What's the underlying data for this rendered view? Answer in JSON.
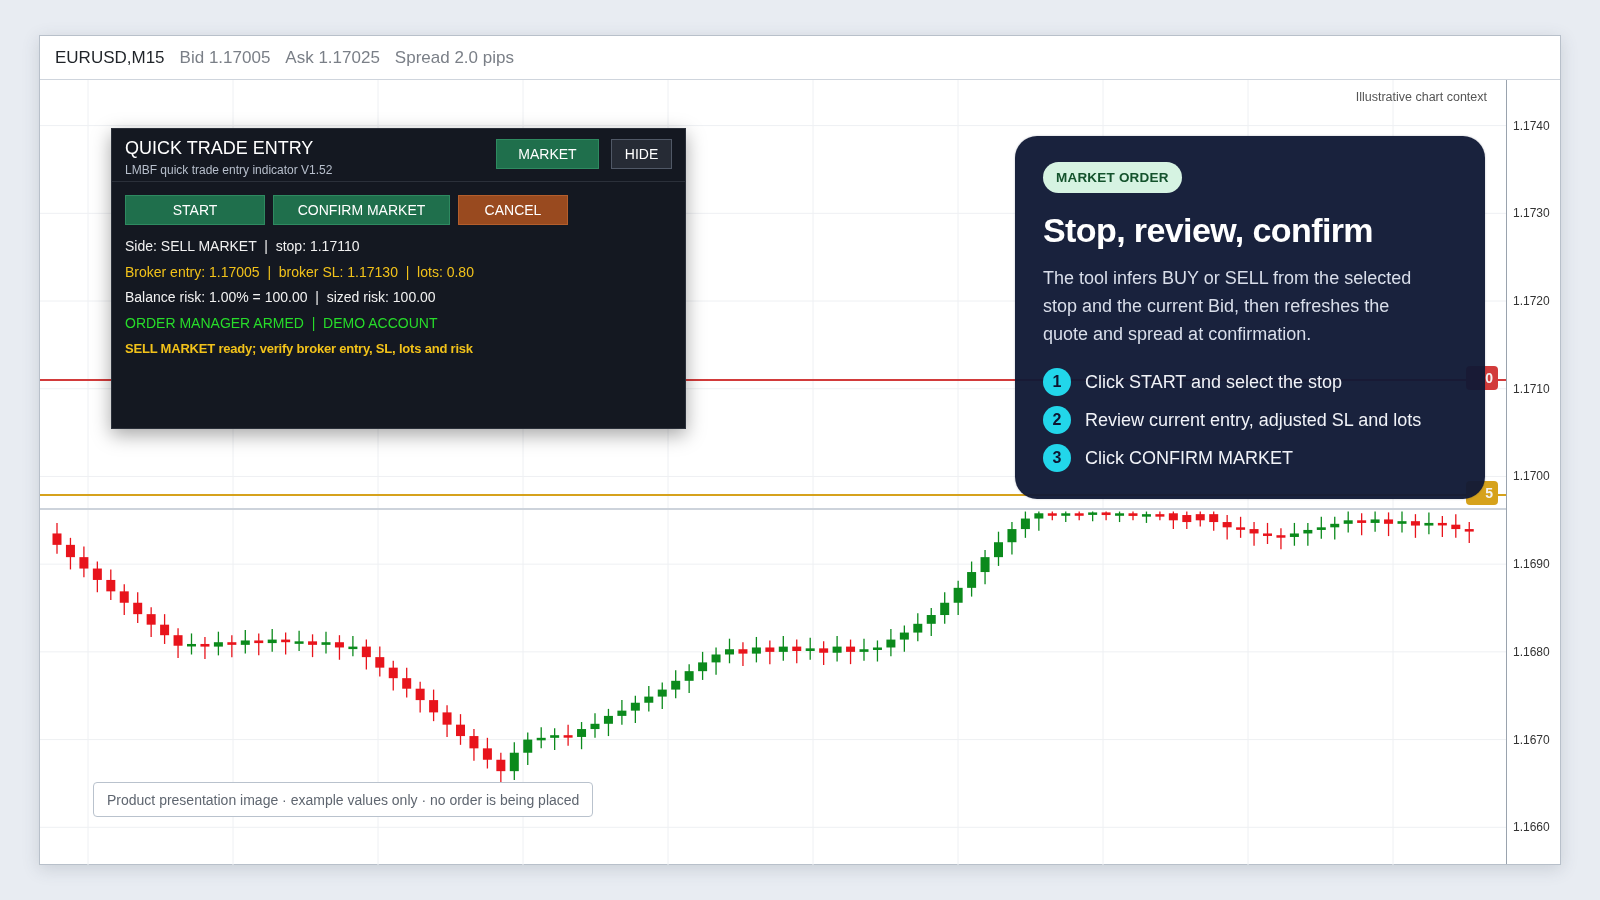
{
  "header": {
    "symbol": "EURUSD,M15",
    "bid": "Bid 1.17005",
    "ask": "Ask 1.17025",
    "spread": "Spread 2.0 pips"
  },
  "chart": {
    "note": "Illustrative chart context",
    "levels": [
      {
        "kind": "stop",
        "label": "0",
        "color": "#d23b3b"
      },
      {
        "kind": "entry",
        "label": "5",
        "color": "#d6a21c"
      },
      {
        "kind": "bid",
        "color": "#cdd3db"
      }
    ],
    "chart_data": {
      "type": "candlestick",
      "ylim": [
        1.16557,
        1.17452
      ],
      "grid": true,
      "yticks": [
        {
          "value": 1.174,
          "label": "1.1740"
        },
        {
          "value": 1.173,
          "label": "1.1730"
        },
        {
          "value": 1.172,
          "label": "1.1720"
        },
        {
          "value": 1.171,
          "label": "1.1710"
        },
        {
          "value": 1.17,
          "label": "1.1700"
        },
        {
          "value": 1.169,
          "label": "1.1690"
        },
        {
          "value": 1.168,
          "label": "1.1680"
        },
        {
          "value": 1.167,
          "label": "1.1670"
        },
        {
          "value": 1.166,
          "label": "1.1660"
        }
      ],
      "ohlc": [
        [
          1.16935,
          1.16947,
          1.16912,
          1.16922
        ],
        [
          1.16922,
          1.1693,
          1.16894,
          1.16908
        ],
        [
          1.16908,
          1.1692,
          1.16885,
          1.16895
        ],
        [
          1.16895,
          1.16903,
          1.16868,
          1.16882
        ],
        [
          1.16882,
          1.16894,
          1.16859,
          1.16869
        ],
        [
          1.16869,
          1.16877,
          1.16842,
          1.16856
        ],
        [
          1.16856,
          1.16868,
          1.16833,
          1.16843
        ],
        [
          1.16843,
          1.16851,
          1.16817,
          1.16831
        ],
        [
          1.16831,
          1.16843,
          1.16809,
          1.16819
        ],
        [
          1.16819,
          1.16827,
          1.16793,
          1.16807
        ],
        [
          1.16807,
          1.16821,
          1.16797,
          1.16809
        ],
        [
          1.16809,
          1.16817,
          1.16792,
          1.16806
        ],
        [
          1.16806,
          1.16823,
          1.16796,
          1.16811
        ],
        [
          1.16811,
          1.16819,
          1.16794,
          1.16808
        ],
        [
          1.16808,
          1.16825,
          1.16798,
          1.16813
        ],
        [
          1.16813,
          1.16821,
          1.16796,
          1.1681
        ],
        [
          1.1681,
          1.16826,
          1.168,
          1.16814
        ],
        [
          1.16814,
          1.16822,
          1.16797,
          1.16811
        ],
        [
          1.16811,
          1.16824,
          1.16801,
          1.16812
        ],
        [
          1.16812,
          1.1682,
          1.16794,
          1.16808
        ],
        [
          1.16808,
          1.16823,
          1.16798,
          1.16811
        ],
        [
          1.16811,
          1.16819,
          1.16791,
          1.16805
        ],
        [
          1.16805,
          1.16818,
          1.16795,
          1.16806
        ],
        [
          1.16806,
          1.16814,
          1.1678,
          1.16794
        ],
        [
          1.16794,
          1.16806,
          1.16772,
          1.16782
        ],
        [
          1.16782,
          1.1679,
          1.16756,
          1.1677
        ],
        [
          1.1677,
          1.16782,
          1.16748,
          1.16758
        ],
        [
          1.16758,
          1.16766,
          1.16731,
          1.16745
        ],
        [
          1.16745,
          1.16757,
          1.16721,
          1.16731
        ],
        [
          1.16731,
          1.16739,
          1.16703,
          1.16717
        ],
        [
          1.16717,
          1.16729,
          1.16694,
          1.16704
        ],
        [
          1.16704,
          1.16712,
          1.16676,
          1.1669
        ],
        [
          1.1669,
          1.16702,
          1.16667,
          1.16677
        ],
        [
          1.16677,
          1.16685,
          1.1665,
          1.16664
        ],
        [
          1.16664,
          1.16697,
          1.16654,
          1.16685
        ],
        [
          1.16685,
          1.16708,
          1.16671,
          1.167
        ],
        [
          1.167,
          1.16714,
          1.1669,
          1.16702
        ],
        [
          1.16702,
          1.16713,
          1.16688,
          1.16705
        ],
        [
          1.16705,
          1.16717,
          1.16693,
          1.16703
        ],
        [
          1.16703,
          1.1672,
          1.16689,
          1.16712
        ],
        [
          1.16712,
          1.1673,
          1.16702,
          1.16718
        ],
        [
          1.16718,
          1.16735,
          1.16704,
          1.16727
        ],
        [
          1.16727,
          1.16745,
          1.16717,
          1.16733
        ],
        [
          1.16733,
          1.1675,
          1.16719,
          1.16742
        ],
        [
          1.16742,
          1.16761,
          1.16732,
          1.16749
        ],
        [
          1.16749,
          1.16765,
          1.16735,
          1.16757
        ],
        [
          1.16757,
          1.16779,
          1.16747,
          1.16767
        ],
        [
          1.16767,
          1.16786,
          1.16753,
          1.16778
        ],
        [
          1.16778,
          1.168,
          1.16768,
          1.16788
        ],
        [
          1.16788,
          1.16805,
          1.16774,
          1.16797
        ],
        [
          1.16797,
          1.16815,
          1.16787,
          1.16803
        ],
        [
          1.16803,
          1.16811,
          1.16784,
          1.16798
        ],
        [
          1.16798,
          1.16817,
          1.16788,
          1.16805
        ],
        [
          1.16805,
          1.16813,
          1.16786,
          1.168
        ],
        [
          1.168,
          1.16818,
          1.1679,
          1.16806
        ],
        [
          1.16806,
          1.16814,
          1.16787,
          1.16801
        ],
        [
          1.16801,
          1.16816,
          1.16791,
          1.16804
        ],
        [
          1.16804,
          1.16812,
          1.16785,
          1.16799
        ],
        [
          1.16799,
          1.16818,
          1.16789,
          1.16806
        ],
        [
          1.16806,
          1.16814,
          1.16786,
          1.168
        ],
        [
          1.168,
          1.16815,
          1.1679,
          1.16803
        ],
        [
          1.16803,
          1.16813,
          1.16789,
          1.16805
        ],
        [
          1.16805,
          1.16826,
          1.16795,
          1.16814
        ],
        [
          1.16814,
          1.1683,
          1.168,
          1.16822
        ],
        [
          1.16822,
          1.16844,
          1.16812,
          1.16832
        ],
        [
          1.16832,
          1.1685,
          1.16818,
          1.16842
        ],
        [
          1.16842,
          1.16868,
          1.16832,
          1.16856
        ],
        [
          1.16856,
          1.16881,
          1.16842,
          1.16873
        ],
        [
          1.16873,
          1.16903,
          1.16863,
          1.16891
        ],
        [
          1.16891,
          1.16916,
          1.16877,
          1.16908
        ],
        [
          1.16908,
          1.16937,
          1.16898,
          1.16925
        ],
        [
          1.16925,
          1.16948,
          1.16911,
          1.1694
        ],
        [
          1.1694,
          1.1696,
          1.1693,
          1.16952
        ],
        [
          1.16952,
          1.1696,
          1.16938,
          1.16958
        ],
        [
          1.16958,
          1.1696,
          1.1695,
          1.16956
        ],
        [
          1.16956,
          1.1696,
          1.16948,
          1.16958
        ],
        [
          1.16958,
          1.1696,
          1.1695,
          1.16957
        ],
        [
          1.16957,
          1.1696,
          1.16949,
          1.16959
        ],
        [
          1.16959,
          1.1696,
          1.1695,
          1.16956
        ],
        [
          1.16956,
          1.1696,
          1.16948,
          1.16958
        ],
        [
          1.16958,
          1.1696,
          1.1695,
          1.16955
        ],
        [
          1.16955,
          1.1696,
          1.16947,
          1.16957
        ],
        [
          1.16957,
          1.1696,
          1.1695,
          1.16955
        ],
        [
          1.16958,
          1.1696,
          1.1694,
          1.1695
        ],
        [
          1.16956,
          1.1696,
          1.1694,
          1.16948
        ],
        [
          1.16957,
          1.1696,
          1.16943,
          1.1695
        ],
        [
          1.16957,
          1.1696,
          1.16938,
          1.16948
        ],
        [
          1.16948,
          1.16956,
          1.16928,
          1.16942
        ],
        [
          1.16942,
          1.16954,
          1.1693,
          1.1694
        ],
        [
          1.1694,
          1.16948,
          1.16921,
          1.16935
        ],
        [
          1.16935,
          1.16947,
          1.16923,
          1.16933
        ],
        [
          1.16933,
          1.16941,
          1.16917,
          1.16931
        ],
        [
          1.16931,
          1.16947,
          1.16921,
          1.16935
        ],
        [
          1.16935,
          1.16947,
          1.16921,
          1.16939
        ],
        [
          1.16939,
          1.16954,
          1.16929,
          1.16942
        ],
        [
          1.16942,
          1.16954,
          1.16928,
          1.16946
        ],
        [
          1.16946,
          1.1696,
          1.16936,
          1.1695
        ],
        [
          1.1695,
          1.16958,
          1.16933,
          1.16947
        ],
        [
          1.16947,
          1.1696,
          1.16937,
          1.16951
        ],
        [
          1.16951,
          1.16959,
          1.16932,
          1.16946
        ],
        [
          1.16946,
          1.1696,
          1.16936,
          1.16949
        ],
        [
          1.16949,
          1.16957,
          1.1693,
          1.16944
        ],
        [
          1.16944,
          1.16959,
          1.16934,
          1.16947
        ],
        [
          1.16947,
          1.16955,
          1.16931,
          1.16945
        ],
        [
          1.16945,
          1.16957,
          1.1693,
          1.1694
        ],
        [
          1.1694,
          1.16948,
          1.16924,
          1.16938
        ]
      ]
    },
    "caption": "Product presentation image · example values only · no order is being placed"
  },
  "trade_panel": {
    "title": "QUICK TRADE ENTRY",
    "subtitle": "LMBF quick trade entry indicator V1.52",
    "header_buttons": [
      {
        "label": "MARKET",
        "kind": "primary"
      },
      {
        "label": "HIDE",
        "kind": "secondary"
      }
    ],
    "actions": [
      {
        "label": "START",
        "kind": "primary"
      },
      {
        "label": "CONFIRM MARKET",
        "kind": "primary"
      },
      {
        "label": "CANCEL",
        "kind": "danger"
      }
    ],
    "lines": [
      {
        "text": "Side: SELL MARKET  |  stop: 1.17110",
        "kind": "info"
      },
      {
        "text": "Broker entry: 1.17005  |  broker SL: 1.17130  |  lots: 0.80",
        "kind": "warning"
      },
      {
        "text": "Balance risk: 1.00% = 100.00  |  sized risk: 100.00",
        "kind": "info"
      },
      {
        "text": "ORDER MANAGER ARMED  |  DEMO ACCOUNT",
        "kind": "ok"
      },
      {
        "text": "SELL MARKET ready; verify broker entry, SL, lots and risk",
        "kind": "notice"
      }
    ]
  },
  "card": {
    "badge": "MARKET ORDER",
    "title": "Stop, review, confirm",
    "body": "The tool infers BUY or SELL from the selected stop and the current Bid, then refreshes the quote and spread at confirmation.",
    "steps": [
      {
        "number": "1",
        "text": "Click START and select the stop"
      },
      {
        "number": "2",
        "text": "Review current entry, adjusted SL and lots"
      },
      {
        "number": "3",
        "text": "Click CONFIRM MARKET"
      }
    ]
  }
}
